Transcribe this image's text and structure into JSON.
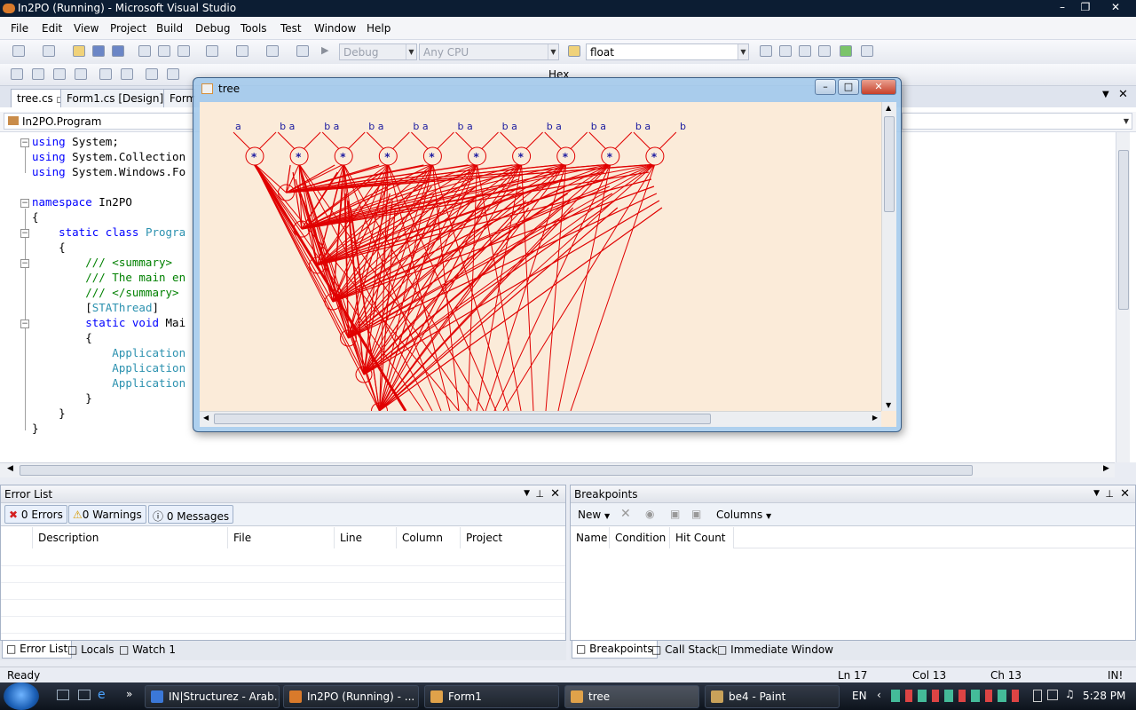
{
  "window": {
    "title": "In2PO (Running) - Microsoft Visual Studio"
  },
  "menu": [
    "File",
    "Edit",
    "View",
    "Project",
    "Build",
    "Debug",
    "Tools",
    "Test",
    "Window",
    "Help"
  ],
  "toolbar": {
    "config": "Debug",
    "platform": "Any CPU",
    "find": "float",
    "hex_label": "Hex"
  },
  "doc_tabs": [
    "tree.cs",
    "Form1.cs [Design]",
    "Form"
  ],
  "nav_combo": "In2PO.Program",
  "code_lines": [
    [
      {
        "t": "using",
        "c": "kw"
      },
      {
        "t": " System;",
        "c": ""
      }
    ],
    [
      {
        "t": "using",
        "c": "kw"
      },
      {
        "t": " System.Collection",
        "c": ""
      }
    ],
    [
      {
        "t": "using",
        "c": "kw"
      },
      {
        "t": " System.Windows.Fo",
        "c": ""
      }
    ],
    [],
    [
      {
        "t": "namespace",
        "c": "kw"
      },
      {
        "t": " In2PO",
        "c": ""
      }
    ],
    [
      {
        "t": "{",
        "c": ""
      }
    ],
    [
      {
        "t": "    static",
        "c": "kw"
      },
      {
        "t": " ",
        "c": ""
      },
      {
        "t": "class",
        "c": "kw"
      },
      {
        "t": " Progra",
        "c": "ty"
      }
    ],
    [
      {
        "t": "    {",
        "c": ""
      }
    ],
    [
      {
        "t": "        /// <summary>",
        "c": "cm"
      }
    ],
    [
      {
        "t": "        /// The main en",
        "c": "cm"
      }
    ],
    [
      {
        "t": "        /// </summary>",
        "c": "cm"
      }
    ],
    [
      {
        "t": "        [",
        "c": ""
      },
      {
        "t": "STAThread",
        "c": "ty"
      },
      {
        "t": "]",
        "c": ""
      }
    ],
    [
      {
        "t": "        static",
        "c": "kw"
      },
      {
        "t": " ",
        "c": ""
      },
      {
        "t": "void",
        "c": "kw"
      },
      {
        "t": " Mai",
        "c": ""
      }
    ],
    [
      {
        "t": "        {",
        "c": ""
      }
    ],
    [
      {
        "t": "            Application",
        "c": "ty"
      }
    ],
    [
      {
        "t": "            Application",
        "c": "ty"
      }
    ],
    [
      {
        "t": "            Application",
        "c": "ty"
      }
    ],
    [
      {
        "t": "        }",
        "c": ""
      }
    ],
    [
      {
        "t": "    }",
        "c": ""
      }
    ],
    [
      {
        "t": "}",
        "c": ""
      }
    ]
  ],
  "error_list": {
    "title": "Error List",
    "errors": "0 Errors",
    "warnings": "0 Warnings",
    "messages": "0 Messages",
    "columns": [
      "Description",
      "File",
      "Line",
      "Column",
      "Project"
    ],
    "tabs": [
      "Error List",
      "Locals",
      "Watch 1"
    ]
  },
  "breakpoints": {
    "title": "Breakpoints",
    "new_label": "New",
    "columns_label": "Columns",
    "columns": [
      "Name",
      "Condition",
      "Hit Count"
    ],
    "tabs": [
      "Breakpoints",
      "Call Stack",
      "Immediate Window"
    ]
  },
  "status": {
    "text": "Ready",
    "ln": "Ln 17",
    "col": "Col 13",
    "ch": "Ch 13",
    "ins": "IN!"
  },
  "taskbar": {
    "buttons": [
      "IN|Structurez - Arab...",
      "In2PO (Running) - ...",
      "Form1",
      "tree",
      "be4 - Paint"
    ],
    "lang": "EN",
    "clock": "5:28 PM"
  },
  "tree_window": {
    "title": "tree",
    "leaf_labels": [
      "a",
      "b a",
      "b a",
      "b a",
      "b a",
      "b a",
      "b a",
      "b a",
      "b a",
      "b a",
      "b"
    ],
    "node_symbol": "*",
    "node_count": 10,
    "colors": {
      "edge": "#e00000",
      "label": "#1a1aa0",
      "background": "#fbebd9"
    }
  }
}
